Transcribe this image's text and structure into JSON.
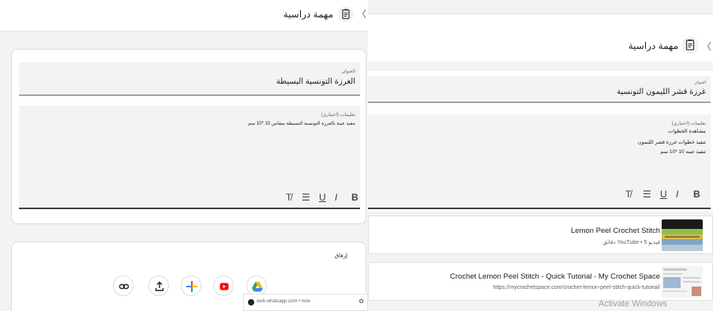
{
  "left": {
    "header_title": "مهمة دراسية",
    "close_glyph": "〈",
    "title_label": "العنوان",
    "title_value": "الغرزة التونسية البسيطة",
    "desc_label": "تعليمات (اختياري)",
    "desc_text": "تنفيذ عينة بالغرزة التونسية البسيطة بمقاس 10 *10 سم",
    "format": {
      "clear": "T̸",
      "list": "☰",
      "underline": "U",
      "italic": "I",
      "bold": "B"
    },
    "attach_label": "إرفاق",
    "notification": {
      "text": "web.whatsapp.com • now",
      "gear": "✿"
    }
  },
  "right": {
    "header_title": "مهمة دراسية",
    "close_glyph": "〈",
    "title_label": "العنوان",
    "title_value": "غرزة قشر الليمون التونسية",
    "desc_label": "تعليمات (اختياري)",
    "desc_lines": [
      "مشاهدة الخطوات",
      "تنفيذ خطوات غرزة قشر الليمون",
      "تنفيذ عينه 10 *10 سم"
    ],
    "format": {
      "clear": "T̸",
      "list": "☰",
      "underline": "U",
      "italic": "I",
      "bold": "B"
    },
    "attachments": [
      {
        "title": "Lemon Peel Crochet Stitch",
        "subtitle": "فيديو YouTube • 5 دقائق"
      },
      {
        "title": "Crochet Lemon Peel Stitch - Quick Tutorial - My Crochet Space",
        "subtitle": "https://mycrochetspace.com/crochet-lemon-peel-stitch-quick-tutorial/"
      }
    ]
  },
  "watermark": "Activate Windows",
  "colors": {
    "drive_blue": "#4285f4",
    "drive_yellow": "#fbbc04",
    "drive_green": "#34a853",
    "youtube_red": "#ff0000",
    "background": "#f1f3f4"
  },
  "icons": [
    "link-icon",
    "upload-icon",
    "create-plus-icon",
    "youtube-icon",
    "drive-icon"
  ]
}
